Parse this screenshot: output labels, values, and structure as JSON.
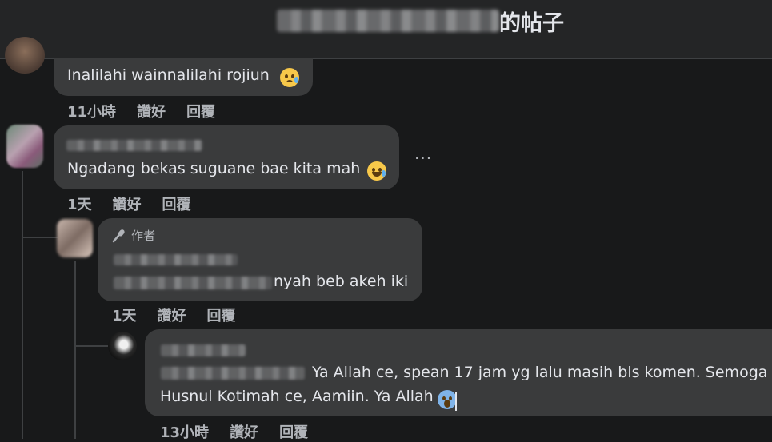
{
  "header": {
    "title_suffix": "的帖子"
  },
  "comments": [
    {
      "text": "Inalilahi wainnalilahi rojiun",
      "emoji": "sad-tear-emoji",
      "time": "11小時",
      "like": "讚好",
      "reply": "回覆"
    },
    {
      "text": "Ngadang bekas suguane bae kita mah",
      "emoji": "rolling-laugh-emoji",
      "time": "1天",
      "like": "讚好",
      "reply": "回覆",
      "more": "···"
    },
    {
      "author_badge": "作者",
      "text": "nyah beb akeh iki",
      "time": "1天",
      "like": "讚好",
      "reply": "回覆"
    },
    {
      "text_line1": "Ya Allah ce, spean 17 jam yg lalu masih bls komen. Semoga",
      "text_line2": "Husnul Kotimah ce, Aamiin. Ya Allah",
      "emoji": "scream-emoji",
      "time": "13小時",
      "like": "讚好",
      "reply": "回覆"
    }
  ],
  "colors": {
    "background": "#18191a",
    "bubble": "#3a3b3c",
    "text": "#e4e6eb",
    "secondary_text": "#b0b3b8"
  }
}
